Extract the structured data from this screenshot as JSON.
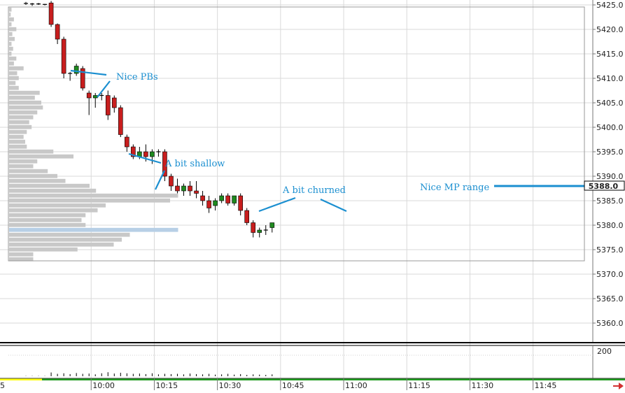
{
  "chart_data": {
    "type": "candlestick",
    "price_axis": {
      "ylim": [
        5356,
        5426
      ],
      "ticks": [
        "5425.0",
        "5420.0",
        "5415.0",
        "5410.0",
        "5405.0",
        "5400.0",
        "5395.0",
        "5390.0",
        "5385.0",
        "5380.0",
        "5375.0",
        "5370.0",
        "5365.0",
        "5360.0"
      ],
      "tick_values": [
        5425,
        5420,
        5415,
        5410,
        5405,
        5400,
        5395,
        5390,
        5385,
        5380,
        5375,
        5370,
        5365,
        5360
      ]
    },
    "last_price": {
      "label": "5388.0",
      "value": 5388.0
    },
    "volume_axis": {
      "ticks": [
        "200"
      ],
      "tick_values": [
        200
      ],
      "ylim": [
        0,
        230
      ]
    },
    "time_axis": {
      "labels": [
        "10:00",
        "10:15",
        "10:30",
        "10:45",
        "11:00",
        "11:15",
        "11:30",
        "11:45"
      ],
      "label_bar_index": [
        12,
        22,
        32,
        42,
        52,
        62,
        72,
        82
      ],
      "left_edge_label": "5"
    },
    "bars": [
      {
        "o": 5425.3,
        "h": 5425.6,
        "l": 5425.0,
        "c": 5425.2
      },
      {
        "o": 5425.2,
        "h": 5425.4,
        "l": 5424.8,
        "c": 5425.2
      },
      {
        "o": 5425.2,
        "h": 5425.4,
        "l": 5425.0,
        "c": 5425.1
      },
      {
        "o": 5425.1,
        "h": 5425.2,
        "l": 5424.9,
        "c": 5425.1
      },
      {
        "o": 5425.4,
        "h": 5425.8,
        "l": 5420.5,
        "c": 5421.0
      },
      {
        "o": 5421.0,
        "h": 5421.2,
        "l": 5417.0,
        "c": 5418.0
      },
      {
        "o": 5418.0,
        "h": 5418.5,
        "l": 5410.0,
        "c": 5411.0
      },
      {
        "o": 5411.0,
        "h": 5411.3,
        "l": 5409.5,
        "c": 5411.0
      },
      {
        "o": 5411.0,
        "h": 5413.0,
        "l": 5410.5,
        "c": 5412.5
      },
      {
        "o": 5412.0,
        "h": 5412.5,
        "l": 5407.5,
        "c": 5408.0
      },
      {
        "o": 5407.0,
        "h": 5407.5,
        "l": 5402.5,
        "c": 5406.0
      },
      {
        "o": 5406.0,
        "h": 5407.0,
        "l": 5404.0,
        "c": 5406.5
      },
      {
        "o": 5406.5,
        "h": 5407.0,
        "l": 5405.5,
        "c": 5406.5
      },
      {
        "o": 5406.5,
        "h": 5407.5,
        "l": 5401.5,
        "c": 5402.5
      },
      {
        "o": 5406.0,
        "h": 5406.5,
        "l": 5403.0,
        "c": 5404.0
      },
      {
        "o": 5404.0,
        "h": 5404.5,
        "l": 5398.0,
        "c": 5398.5
      },
      {
        "o": 5398.0,
        "h": 5398.5,
        "l": 5395.0,
        "c": 5396.0
      },
      {
        "o": 5396.0,
        "h": 5396.5,
        "l": 5393.5,
        "c": 5394.0
      },
      {
        "o": 5394.0,
        "h": 5396.0,
        "l": 5393.5,
        "c": 5395.0
      },
      {
        "o": 5395.0,
        "h": 5396.5,
        "l": 5393.0,
        "c": 5394.0
      },
      {
        "o": 5394.0,
        "h": 5395.5,
        "l": 5392.5,
        "c": 5395.0
      },
      {
        "o": 5395.0,
        "h": 5395.5,
        "l": 5394.0,
        "c": 5395.0
      },
      {
        "o": 5395.0,
        "h": 5395.5,
        "l": 5389.0,
        "c": 5390.0
      },
      {
        "o": 5390.0,
        "h": 5390.5,
        "l": 5387.0,
        "c": 5388.0
      },
      {
        "o": 5388.0,
        "h": 5389.5,
        "l": 5386.5,
        "c": 5387.0
      },
      {
        "o": 5387.0,
        "h": 5388.5,
        "l": 5386.0,
        "c": 5388.0
      },
      {
        "o": 5388.0,
        "h": 5389.0,
        "l": 5386.0,
        "c": 5387.0
      },
      {
        "o": 5387.0,
        "h": 5389.0,
        "l": 5385.5,
        "c": 5386.5
      },
      {
        "o": 5386.0,
        "h": 5387.0,
        "l": 5384.0,
        "c": 5385.0
      },
      {
        "o": 5385.0,
        "h": 5386.0,
        "l": 5382.5,
        "c": 5383.5
      },
      {
        "o": 5384.0,
        "h": 5385.5,
        "l": 5383.0,
        "c": 5385.0
      },
      {
        "o": 5385.0,
        "h": 5386.5,
        "l": 5384.5,
        "c": 5386.0
      },
      {
        "o": 5386.0,
        "h": 5386.5,
        "l": 5384.0,
        "c": 5384.5
      },
      {
        "o": 5384.5,
        "h": 5386.0,
        "l": 5384.0,
        "c": 5386.0
      },
      {
        "o": 5386.0,
        "h": 5386.5,
        "l": 5382.0,
        "c": 5383.0
      },
      {
        "o": 5383.0,
        "h": 5383.5,
        "l": 5380.0,
        "c": 5380.5
      },
      {
        "o": 5380.5,
        "h": 5381.0,
        "l": 5377.5,
        "c": 5378.5
      },
      {
        "o": 5378.5,
        "h": 5379.5,
        "l": 5377.5,
        "c": 5379.0
      },
      {
        "o": 5379.0,
        "h": 5380.0,
        "l": 5378.0,
        "c": 5379.0
      },
      {
        "o": 5379.5,
        "h": 5380.5,
        "l": 5378.5,
        "c": 5380.5
      }
    ],
    "volume": [
      2,
      2,
      2,
      2,
      28,
      18,
      22,
      16,
      24,
      18,
      20,
      14,
      22,
      30,
      20,
      26,
      22,
      18,
      20,
      16,
      22,
      14,
      18,
      16,
      18,
      14,
      20,
      16,
      14,
      18,
      12,
      14,
      18,
      12,
      16,
      10,
      14,
      12,
      10,
      14
    ],
    "profile": [
      {
        "price": 5424,
        "len": 3
      },
      {
        "price": 5423,
        "len": 2
      },
      {
        "price": 5422,
        "len": 6
      },
      {
        "price": 5421,
        "len": 3
      },
      {
        "price": 5420,
        "len": 9
      },
      {
        "price": 5419,
        "len": 4
      },
      {
        "price": 5418,
        "len": 7
      },
      {
        "price": 5417,
        "len": 3
      },
      {
        "price": 5416,
        "len": 5
      },
      {
        "price": 5415,
        "len": 3
      },
      {
        "price": 5414,
        "len": 9
      },
      {
        "price": 5413,
        "len": 6
      },
      {
        "price": 5412,
        "len": 18
      },
      {
        "price": 5411,
        "len": 10
      },
      {
        "price": 5410,
        "len": 12
      },
      {
        "price": 5409,
        "len": 8
      },
      {
        "price": 5408,
        "len": 12
      },
      {
        "price": 5407,
        "len": 38
      },
      {
        "price": 5406,
        "len": 32
      },
      {
        "price": 5405,
        "len": 40
      },
      {
        "price": 5404,
        "len": 42
      },
      {
        "price": 5403,
        "len": 35
      },
      {
        "price": 5402,
        "len": 30
      },
      {
        "price": 5401,
        "len": 25
      },
      {
        "price": 5400,
        "len": 28
      },
      {
        "price": 5399,
        "len": 22
      },
      {
        "price": 5398,
        "len": 18
      },
      {
        "price": 5397,
        "len": 20
      },
      {
        "price": 5396,
        "len": 22
      },
      {
        "price": 5395,
        "len": 55
      },
      {
        "price": 5394,
        "len": 80
      },
      {
        "price": 5393,
        "len": 35
      },
      {
        "price": 5392,
        "len": 30
      },
      {
        "price": 5391,
        "len": 48
      },
      {
        "price": 5390,
        "len": 60
      },
      {
        "price": 5389,
        "len": 70
      },
      {
        "price": 5388,
        "len": 100
      },
      {
        "price": 5387,
        "len": 108
      },
      {
        "price": 5386,
        "len": 210
      },
      {
        "price": 5385,
        "len": 200
      },
      {
        "price": 5384,
        "len": 120
      },
      {
        "price": 5383,
        "len": 110
      },
      {
        "price": 5382,
        "len": 95
      },
      {
        "price": 5381,
        "len": 90
      },
      {
        "price": 5380,
        "len": 95
      },
      {
        "price": 5379,
        "len": 210,
        "poc": true
      },
      {
        "price": 5378,
        "len": 150
      },
      {
        "price": 5377,
        "len": 140
      },
      {
        "price": 5376,
        "len": 130
      },
      {
        "price": 5375,
        "len": 85
      },
      {
        "price": 5374,
        "len": 30
      },
      {
        "price": 5373,
        "len": 30
      }
    ],
    "annotations": [
      {
        "text": "Nice PBs"
      },
      {
        "text": "A bit shallow"
      },
      {
        "text": "A bit churned"
      },
      {
        "text": "Nice MP range"
      }
    ],
    "colors": {
      "up": "#1f8a1f",
      "down": "#c81e1e",
      "annotation": "#1b8fd0",
      "profile": "#c8c8c8",
      "poc": "#b7cfe6",
      "grid": "#d9d9d9"
    }
  }
}
